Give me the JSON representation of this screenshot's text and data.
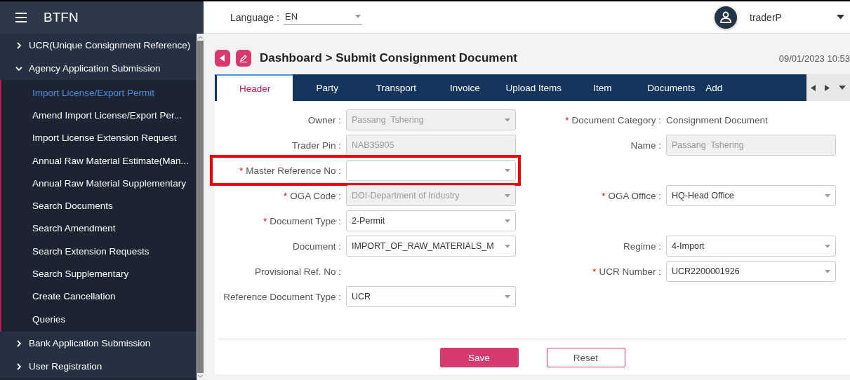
{
  "app": {
    "title": "BTFN"
  },
  "sidebar": {
    "groups": [
      {
        "label": "UCR(Unique Consignment Reference)",
        "expanded": false
      },
      {
        "label": "Agency Application Submission",
        "expanded": true,
        "children": [
          {
            "label": "Import License/Export Permit",
            "selected": true
          },
          {
            "label": "Amend Import License/Export Per...",
            "selected": false
          },
          {
            "label": "Import License Extension Request",
            "selected": false
          },
          {
            "label": "Annual Raw Material Estimate(Man...",
            "selected": false
          },
          {
            "label": "Annual Raw Material Supplementary",
            "selected": false
          },
          {
            "label": "Search Documents",
            "selected": false
          },
          {
            "label": "Search Amendment",
            "selected": false
          },
          {
            "label": "Search Extension Requests",
            "selected": false
          },
          {
            "label": "Search Supplementary",
            "selected": false
          },
          {
            "label": "Create Cancellation",
            "selected": false
          },
          {
            "label": "Queries",
            "selected": false
          }
        ]
      },
      {
        "label": "Bank Application Submission",
        "expanded": false
      },
      {
        "label": "User Registration",
        "expanded": false
      }
    ]
  },
  "topbar": {
    "language_label": "Language :",
    "language": "EN",
    "user": "traderP"
  },
  "page": {
    "breadcrumb": "Dashboard > Submit Consignment Document",
    "datetime": "09/01/2023 10:53"
  },
  "tabs": [
    {
      "label": "Header",
      "selected": true
    },
    {
      "label": "Party",
      "selected": false
    },
    {
      "label": "Transport",
      "selected": false
    },
    {
      "label": "Invoice",
      "selected": false
    },
    {
      "label": "Upload Items",
      "selected": false
    },
    {
      "label": "Item",
      "selected": false
    },
    {
      "label": "Documents",
      "selected": false
    },
    {
      "label": "Add",
      "selected": false
    }
  ],
  "form": {
    "rows": [
      {
        "left": {
          "label": "Owner :",
          "kind": "select",
          "disabled": true,
          "value": "Passang  Tshering"
        },
        "right": {
          "label": "Document Category :",
          "kind": "text",
          "required_mark": "*",
          "value": "Consignment Document"
        }
      },
      {
        "left": {
          "label": "Trader Pin :",
          "kind": "input",
          "disabled": true,
          "value": "NAB35905"
        },
        "right": {
          "label": "Name :",
          "kind": "input",
          "disabled": true,
          "value": "Passang  Tshering"
        }
      },
      {
        "left": {
          "label": "Master Reference No :",
          "kind": "select",
          "required_mark": "*",
          "disabled": false,
          "highlighted": true
        }
      },
      {
        "left": {
          "label": "OGA Code :",
          "kind": "select",
          "required_mark": "*",
          "disabled": true,
          "value": "DOI-Department of Industry"
        },
        "right": {
          "label": "OGA Office :",
          "kind": "select",
          "required_mark": "*",
          "disabled": false,
          "value": "HQ-Head Office"
        }
      },
      {
        "left": {
          "label": "Document Type :",
          "kind": "select",
          "required_mark": "*",
          "disabled": false,
          "value": "2-Permit"
        }
      },
      {
        "left": {
          "label": "Document :",
          "kind": "select",
          "disabled": false,
          "value": "IMPORT_OF_RAW_MATERIALS_M"
        },
        "right": {
          "label": "Regime :",
          "kind": "select",
          "disabled": false,
          "value": "4-Import"
        }
      },
      {
        "left": {
          "label": "Provisional Ref. No :",
          "kind": "label"
        },
        "right": {
          "label": "UCR Number :",
          "kind": "select",
          "required_mark": "*",
          "disabled": false,
          "value": "UCR2200001926"
        }
      },
      {
        "left": {
          "label": "Reference Document Type :",
          "kind": "select",
          "disabled": false,
          "value": "UCR"
        }
      }
    ]
  },
  "buttons": [
    {
      "label": "Save",
      "kind": "primary"
    },
    {
      "label": "Reset",
      "kind": "secondary"
    }
  ]
}
